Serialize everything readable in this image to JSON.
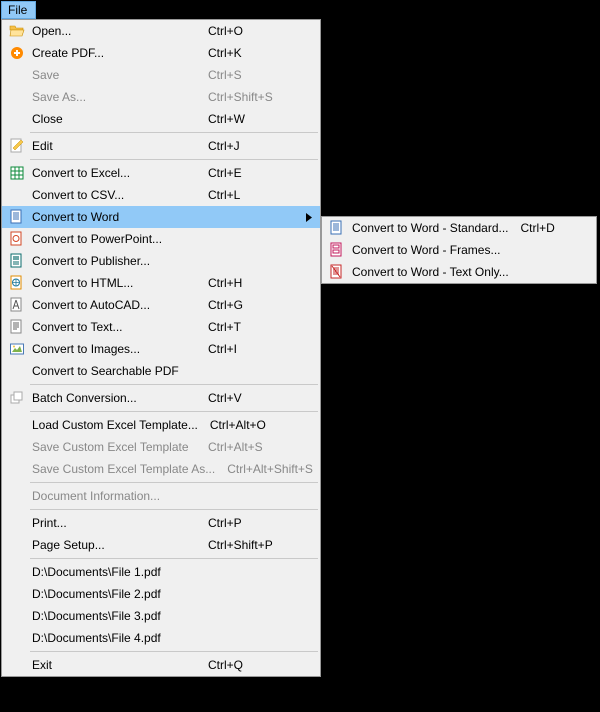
{
  "menubar": {
    "file": "File"
  },
  "menu": [
    {
      "icon": "folder-open-icon",
      "label": "Open...",
      "shortcut": "Ctrl+O",
      "enabled": true
    },
    {
      "icon": "create-pdf-icon",
      "label": "Create PDF...",
      "shortcut": "Ctrl+K",
      "enabled": true
    },
    {
      "icon": null,
      "label": "Save",
      "shortcut": "Ctrl+S",
      "enabled": false
    },
    {
      "icon": null,
      "label": "Save As...",
      "shortcut": "Ctrl+Shift+S",
      "enabled": false
    },
    {
      "icon": null,
      "label": "Close",
      "shortcut": "Ctrl+W",
      "enabled": true
    },
    {
      "sep": true
    },
    {
      "icon": "edit-icon",
      "label": "Edit",
      "shortcut": "Ctrl+J",
      "enabled": true
    },
    {
      "sep": true
    },
    {
      "icon": "excel-icon",
      "label": "Convert to Excel...",
      "shortcut": "Ctrl+E",
      "enabled": true
    },
    {
      "icon": null,
      "label": "Convert to CSV...",
      "shortcut": "Ctrl+L",
      "enabled": true
    },
    {
      "icon": "word-icon",
      "label": "Convert to Word",
      "shortcut": "",
      "enabled": true,
      "submenu": true,
      "highlight": true
    },
    {
      "icon": "powerpoint-icon",
      "label": "Convert to PowerPoint...",
      "shortcut": "",
      "enabled": true
    },
    {
      "icon": "publisher-icon",
      "label": "Convert to Publisher...",
      "shortcut": "",
      "enabled": true
    },
    {
      "icon": "html-icon",
      "label": "Convert to HTML...",
      "shortcut": "Ctrl+H",
      "enabled": true
    },
    {
      "icon": "autocad-icon",
      "label": "Convert to AutoCAD...",
      "shortcut": "Ctrl+G",
      "enabled": true
    },
    {
      "icon": "text-icon",
      "label": "Convert to Text...",
      "shortcut": "Ctrl+T",
      "enabled": true
    },
    {
      "icon": "image-icon",
      "label": "Convert to Images...",
      "shortcut": "Ctrl+I",
      "enabled": true
    },
    {
      "icon": null,
      "label": "Convert to Searchable PDF",
      "shortcut": "",
      "enabled": true
    },
    {
      "sep": true
    },
    {
      "icon": "batch-icon",
      "label": "Batch Conversion...",
      "shortcut": "Ctrl+V",
      "enabled": true
    },
    {
      "sep": true
    },
    {
      "icon": null,
      "label": "Load Custom Excel Template...",
      "shortcut": "Ctrl+Alt+O",
      "enabled": true
    },
    {
      "icon": null,
      "label": "Save Custom Excel Template",
      "shortcut": "Ctrl+Alt+S",
      "enabled": false
    },
    {
      "icon": null,
      "label": "Save Custom Excel Template As...",
      "shortcut": "Ctrl+Alt+Shift+S",
      "enabled": false
    },
    {
      "sep": true
    },
    {
      "icon": null,
      "label": "Document Information...",
      "shortcut": "",
      "enabled": false
    },
    {
      "sep": true
    },
    {
      "icon": null,
      "label": "Print...",
      "shortcut": "Ctrl+P",
      "enabled": true
    },
    {
      "icon": null,
      "label": "Page Setup...",
      "shortcut": "Ctrl+Shift+P",
      "enabled": true
    },
    {
      "sep": true
    },
    {
      "icon": null,
      "label": "D:\\Documents\\File 1.pdf",
      "shortcut": "",
      "enabled": true
    },
    {
      "icon": null,
      "label": "D:\\Documents\\File 2.pdf",
      "shortcut": "",
      "enabled": true
    },
    {
      "icon": null,
      "label": "D:\\Documents\\File 3.pdf",
      "shortcut": "",
      "enabled": true
    },
    {
      "icon": null,
      "label": "D:\\Documents\\File 4.pdf",
      "shortcut": "",
      "enabled": true
    },
    {
      "sep": true
    },
    {
      "icon": null,
      "label": "Exit",
      "shortcut": "Ctrl+Q",
      "enabled": true
    }
  ],
  "submenu": [
    {
      "icon": "word-icon",
      "label": "Convert to Word - Standard...",
      "shortcut": "Ctrl+D"
    },
    {
      "icon": "word-frames-icon",
      "label": "Convert to Word - Frames...",
      "shortcut": ""
    },
    {
      "icon": "word-textonly-icon",
      "label": "Convert to Word - Text Only...",
      "shortcut": ""
    }
  ]
}
